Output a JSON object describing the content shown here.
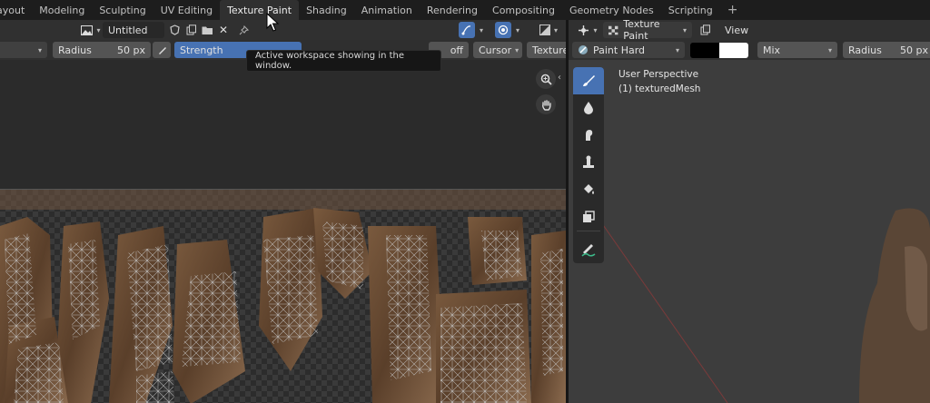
{
  "workspaces": [
    "ayout",
    "Modeling",
    "Sculpting",
    "UV Editing",
    "Texture Paint",
    "Shading",
    "Animation",
    "Rendering",
    "Compositing",
    "Geometry Nodes",
    "Scripting",
    "+"
  ],
  "active_workspace": "Texture Paint",
  "tooltip": "Active workspace showing in the window.",
  "image_editor": {
    "image_name": "Untitled",
    "radius_label": "Radius",
    "radius_value": "50 px",
    "strength_label": "Strength",
    "falloff_label": "off",
    "cursor_label": "Cursor",
    "texture_label": "Texture"
  },
  "viewport": {
    "mode": "Texture Paint",
    "view_menu": "View",
    "brush_name": "Paint Hard",
    "color1": "#000000",
    "color2": "#ffffff",
    "blend": "Mix",
    "radius_label": "Radius",
    "radius_value": "50 px",
    "perspective": "User Perspective",
    "object": "(1) texturedMesh"
  },
  "tools": [
    "draw-brush-icon",
    "soften-icon",
    "smear-icon",
    "clone-icon",
    "fill-icon",
    "mask-icon",
    "annotate-icon"
  ],
  "colors": {
    "accent": "#4772b3",
    "panel": "#303030",
    "viewport": "#3d3d3d"
  }
}
